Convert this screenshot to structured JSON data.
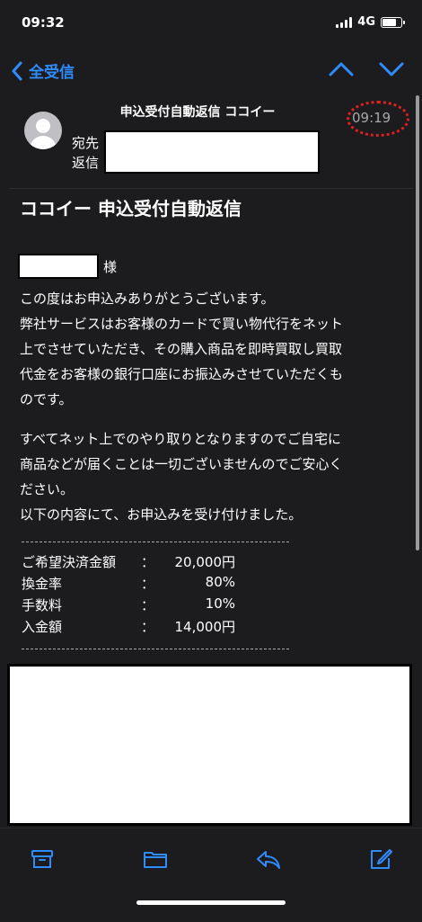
{
  "status": {
    "time": "09:32",
    "network": "4G"
  },
  "nav": {
    "back_label": "全受信"
  },
  "header": {
    "subject_small": "申込受付自動返信 ココイー",
    "time": "09:19",
    "to_label": "宛先",
    "reply_label": "返信"
  },
  "mail": {
    "title": "ココイー 申込受付自動返信",
    "honorific": "様",
    "paragraph1": [
      "この度はお申込みありがとうございます。",
      "弊社サービスはお客様のカードで買い物代行をネット",
      "上でさせていただき、その購入商品を即時買取し買取",
      "代金をお客様の銀行口座にお振込みさせていただくも",
      "のです。"
    ],
    "paragraph2": [
      "すべてネット上でのやり取りとなりますのでご自宅に",
      "商品などが届くことは一切ございませんのでご安心く",
      "ださい。",
      "以下の内容にて、お申込みを受け付けました。"
    ],
    "separator": "---------------------------------------------------",
    "table": [
      {
        "label": "ご希望決済金額",
        "colon": "：",
        "value": "20,000円"
      },
      {
        "label": "換金率",
        "colon": "：",
        "value": "80%"
      },
      {
        "label": "手数料",
        "colon": "：",
        "value": "10%"
      },
      {
        "label": "入金額",
        "colon": "：",
        "value": "14,000円"
      }
    ]
  },
  "colors": {
    "accent": "#2f8cff",
    "background": "#1c1c1e",
    "highlight_ring": "#e02020"
  },
  "icons": [
    "chevron-left-icon",
    "chevron-up-icon",
    "chevron-down-icon",
    "archive-icon",
    "folder-icon",
    "reply-icon",
    "compose-icon"
  ]
}
